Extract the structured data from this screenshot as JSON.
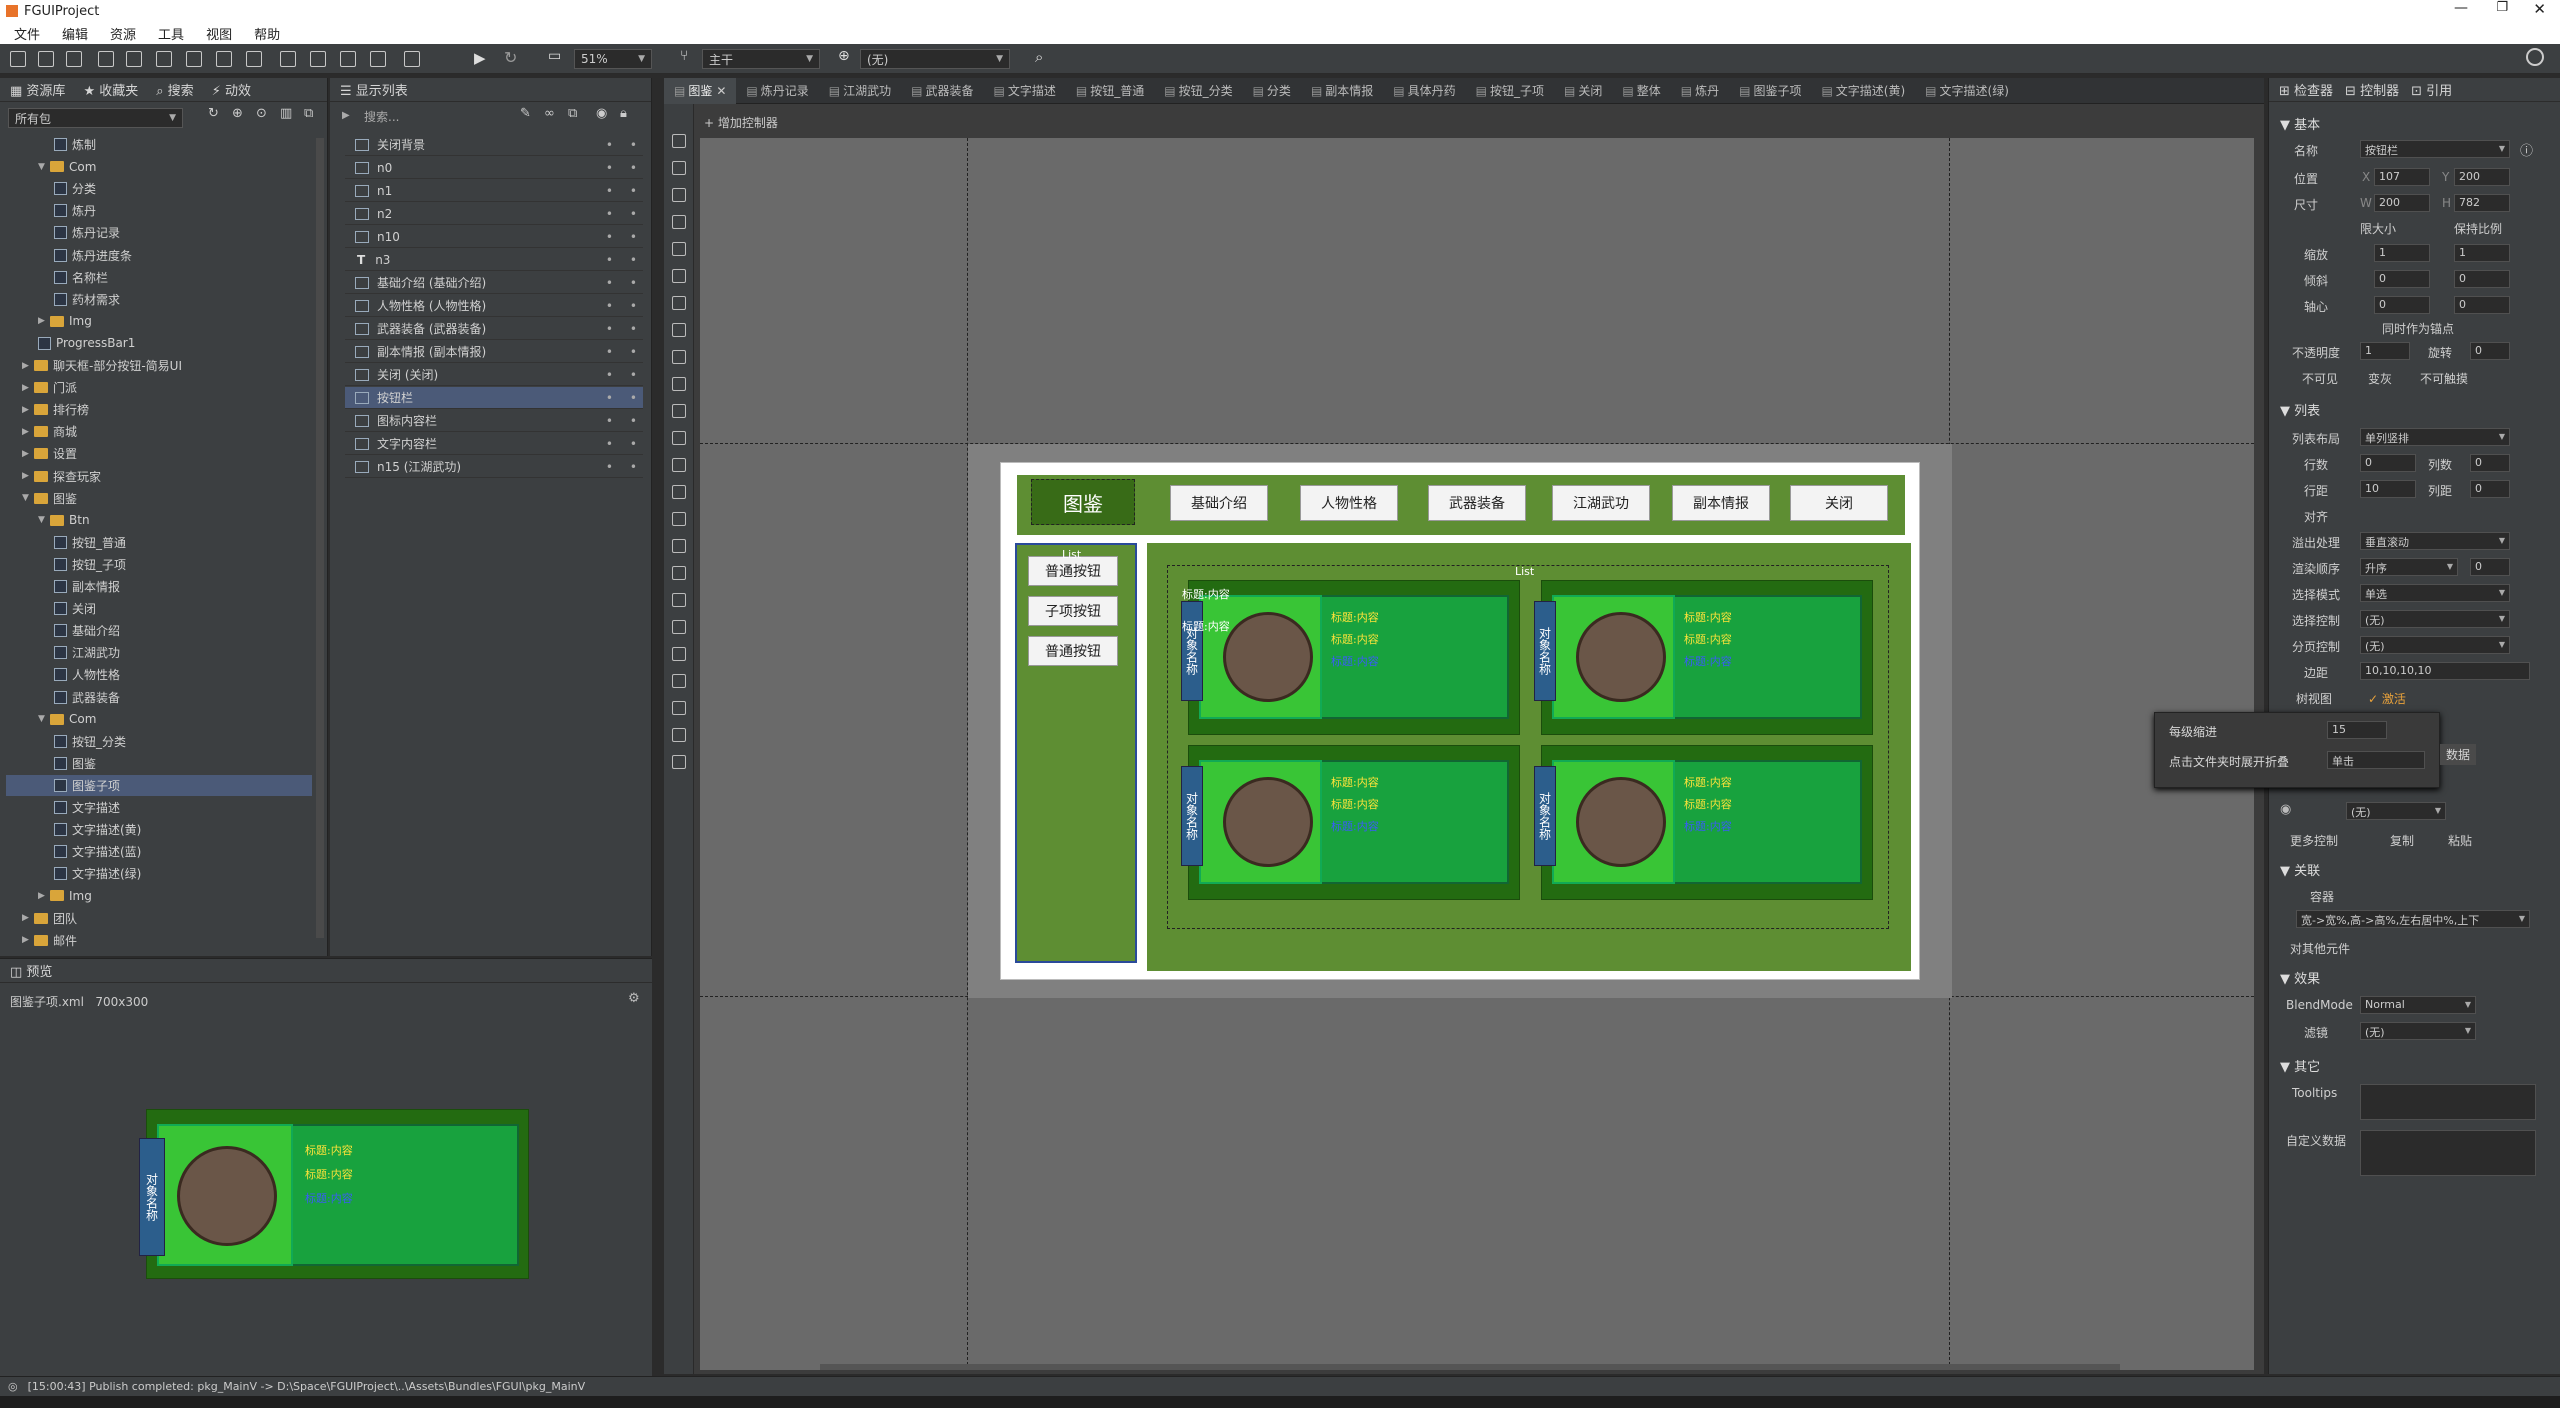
{
  "window": {
    "title": "FGUIProject"
  },
  "menu": [
    "文件",
    "编辑",
    "资源",
    "工具",
    "视图",
    "帮助"
  ],
  "toolbar": {
    "branch": "主干",
    "lang": "(无)",
    "zoom": "51%"
  },
  "library": {
    "tabs": [
      "资源库",
      "收藏夹",
      "搜索",
      "动效"
    ],
    "filter": "所有包",
    "items": [
      {
        "label": "炼制",
        "indent": 3,
        "type": "cmp"
      },
      {
        "label": "Com",
        "indent": 2,
        "type": "folder",
        "open": true
      },
      {
        "label": "分类",
        "indent": 3,
        "type": "cmp"
      },
      {
        "label": "炼丹",
        "indent": 3,
        "type": "cmp"
      },
      {
        "label": "炼丹记录",
        "indent": 3,
        "type": "cmp"
      },
      {
        "label": "炼丹进度条",
        "indent": 3,
        "type": "cmp"
      },
      {
        "label": "名称栏",
        "indent": 3,
        "type": "cmp"
      },
      {
        "label": "药材需求",
        "indent": 3,
        "type": "cmp"
      },
      {
        "label": "Img",
        "indent": 2,
        "type": "folder"
      },
      {
        "label": "ProgressBar1",
        "indent": 2,
        "type": "cmp"
      },
      {
        "label": "聊天框-部分按钮-简易UI",
        "indent": 1,
        "type": "folder"
      },
      {
        "label": "门派",
        "indent": 1,
        "type": "folder"
      },
      {
        "label": "排行榜",
        "indent": 1,
        "type": "folder"
      },
      {
        "label": "商城",
        "indent": 1,
        "type": "folder"
      },
      {
        "label": "设置",
        "indent": 1,
        "type": "folder"
      },
      {
        "label": "探查玩家",
        "indent": 1,
        "type": "folder"
      },
      {
        "label": "图鉴",
        "indent": 1,
        "type": "folder",
        "open": true
      },
      {
        "label": "Btn",
        "indent": 2,
        "type": "folder",
        "open": true
      },
      {
        "label": "按钮_普通",
        "indent": 3,
        "type": "cmp"
      },
      {
        "label": "按钮_子项",
        "indent": 3,
        "type": "cmp"
      },
      {
        "label": "副本情报",
        "indent": 3,
        "type": "cmp"
      },
      {
        "label": "关闭",
        "indent": 3,
        "type": "cmp"
      },
      {
        "label": "基础介绍",
        "indent": 3,
        "type": "cmp"
      },
      {
        "label": "江湖武功",
        "indent": 3,
        "type": "cmp"
      },
      {
        "label": "人物性格",
        "indent": 3,
        "type": "cmp"
      },
      {
        "label": "武器装备",
        "indent": 3,
        "type": "cmp"
      },
      {
        "label": "Com",
        "indent": 2,
        "type": "folder",
        "open": true
      },
      {
        "label": "按钮_分类",
        "indent": 3,
        "type": "cmp"
      },
      {
        "label": "图鉴",
        "indent": 3,
        "type": "cmp"
      },
      {
        "label": "图鉴子项",
        "indent": 3,
        "type": "cmp",
        "selected": true
      },
      {
        "label": "文字描述",
        "indent": 3,
        "type": "cmp"
      },
      {
        "label": "文字描述(黄)",
        "indent": 3,
        "type": "cmp"
      },
      {
        "label": "文字描述(蓝)",
        "indent": 3,
        "type": "cmp"
      },
      {
        "label": "文字描述(绿)",
        "indent": 3,
        "type": "cmp"
      },
      {
        "label": "Img",
        "indent": 2,
        "type": "folder"
      },
      {
        "label": "团队",
        "indent": 1,
        "type": "folder"
      },
      {
        "label": "邮件",
        "indent": 1,
        "type": "folder"
      }
    ]
  },
  "display_list": {
    "title": "显示列表",
    "search": "搜索...",
    "items": [
      {
        "label": "关闭背景",
        "type": "img"
      },
      {
        "label": "n0",
        "type": "img"
      },
      {
        "label": "n1",
        "type": "img"
      },
      {
        "label": "n2",
        "type": "img"
      },
      {
        "label": "n10",
        "type": "img"
      },
      {
        "label": "n3",
        "type": "text"
      },
      {
        "label": "基础介绍 (基础介绍)",
        "type": "cmp"
      },
      {
        "label": "人物性格 (人物性格)",
        "type": "cmp"
      },
      {
        "label": "武器装备 (武器装备)",
        "type": "cmp"
      },
      {
        "label": "副本情报 (副本情报)",
        "type": "cmp"
      },
      {
        "label": "关闭 (关闭)",
        "type": "cmp"
      },
      {
        "label": "按钮栏",
        "type": "list",
        "selected": true
      },
      {
        "label": "图标内容栏",
        "type": "list"
      },
      {
        "label": "文字内容栏",
        "type": "list"
      },
      {
        "label": "n15 (江湖武功)",
        "type": "cmp"
      }
    ]
  },
  "preview": {
    "title": "预览",
    "file": "图鉴子项.xml",
    "size": "700x300"
  },
  "doc_tabs": [
    "图鉴",
    "炼丹记录",
    "江湖武功",
    "武器装备",
    "文字描述",
    "按钮_普通",
    "按钮_分类",
    "分类",
    "副本情报",
    "具体丹药",
    "按钮_子项",
    "关闭",
    "整体",
    "炼丹",
    "图鉴子项",
    "文字描述(黄)",
    "文字描述(绿)"
  ],
  "canvas": {
    "add_controller": "增加控制器",
    "title_text": "图鉴",
    "top_buttons": [
      "基础介绍",
      "人物性格",
      "武器装备",
      "江湖武功",
      "副本情报",
      "关闭"
    ],
    "side_buttons": [
      "普通按钮",
      "子项按钮",
      "普通按钮"
    ],
    "list_label": "List",
    "card": {
      "name": "对象名称",
      "lines": [
        "标题:内容",
        "标题:内容",
        "标题:内容"
      ],
      "overlay": "标题:内容"
    }
  },
  "inspector": {
    "tabs": [
      "检查器",
      "控制器",
      "引用"
    ],
    "basic": "基本",
    "name_label": "名称",
    "name_value": "按钮栏",
    "pos_label": "位置",
    "x": "107",
    "y": "200",
    "size_label": "尺寸",
    "w": "200",
    "h": "782",
    "min_label": "限大小",
    "keep_ratio": "保持比例",
    "scale_label": "缩放",
    "sx": "1",
    "sy": "1",
    "skew_label": "倾斜",
    "kx": "0",
    "ky": "0",
    "pivot_label": "轴心",
    "px": "0",
    "py": "0",
    "pivot_anchor": "同时作为锚点",
    "alpha_label": "不透明度",
    "alpha": "1",
    "rot_label": "旋转",
    "rot": "0",
    "invisible": "不可见",
    "gray": "变灰",
    "untouchable": "不可触摸",
    "list_section": "列表",
    "layout_label": "列表布局",
    "layout": "单列竖排",
    "rows_label": "行数",
    "rows": "0",
    "cols_label": "列数",
    "cols": "0",
    "row_gap_label": "行距",
    "row_gap": "10",
    "col_gap_label": "列距",
    "col_gap": "0",
    "align_label": "对齐",
    "overflow_label": "溢出处理",
    "overflow": "垂直滚动",
    "order_label": "渲染顺序",
    "order": "升序",
    "order_n": "0",
    "sel_mode_label": "选择模式",
    "sel_mode": "单选",
    "sel_ctrl_label": "选择控制",
    "sel_ctrl": "(无)",
    "page_ctrl_label": "分页控制",
    "page_ctrl": "(无)",
    "margin_label": "边距",
    "margin": "10,10,10,10",
    "tree_label": "树视图",
    "tree": "激活",
    "popup": {
      "indent_label": "每级缩进",
      "indent": "15",
      "click_label": "点击文件夹时展开折叠",
      "click": "单击"
    },
    "data_btn": "数据",
    "none": "(无)",
    "more_ctrl": "更多控制",
    "copy": "复制",
    "paste": "粘贴",
    "relation": "关联",
    "container": "容器",
    "rel_value": "宽->宽%,高->高%,左右居中%,上下",
    "other_comp": "对其他元件",
    "effect": "效果",
    "blend_label": "BlendMode",
    "blend": "Normal",
    "filter_label": "滤镜",
    "filter": "(无)",
    "other": "其它",
    "tooltips": "Tooltips",
    "custom": "自定义数据"
  },
  "status": "[15:00:43] Publish completed: pkg_MainV -> D:\\Space\\FGUIProject\\..\\Assets\\Bundles\\FGUI\\pkg_MainV"
}
